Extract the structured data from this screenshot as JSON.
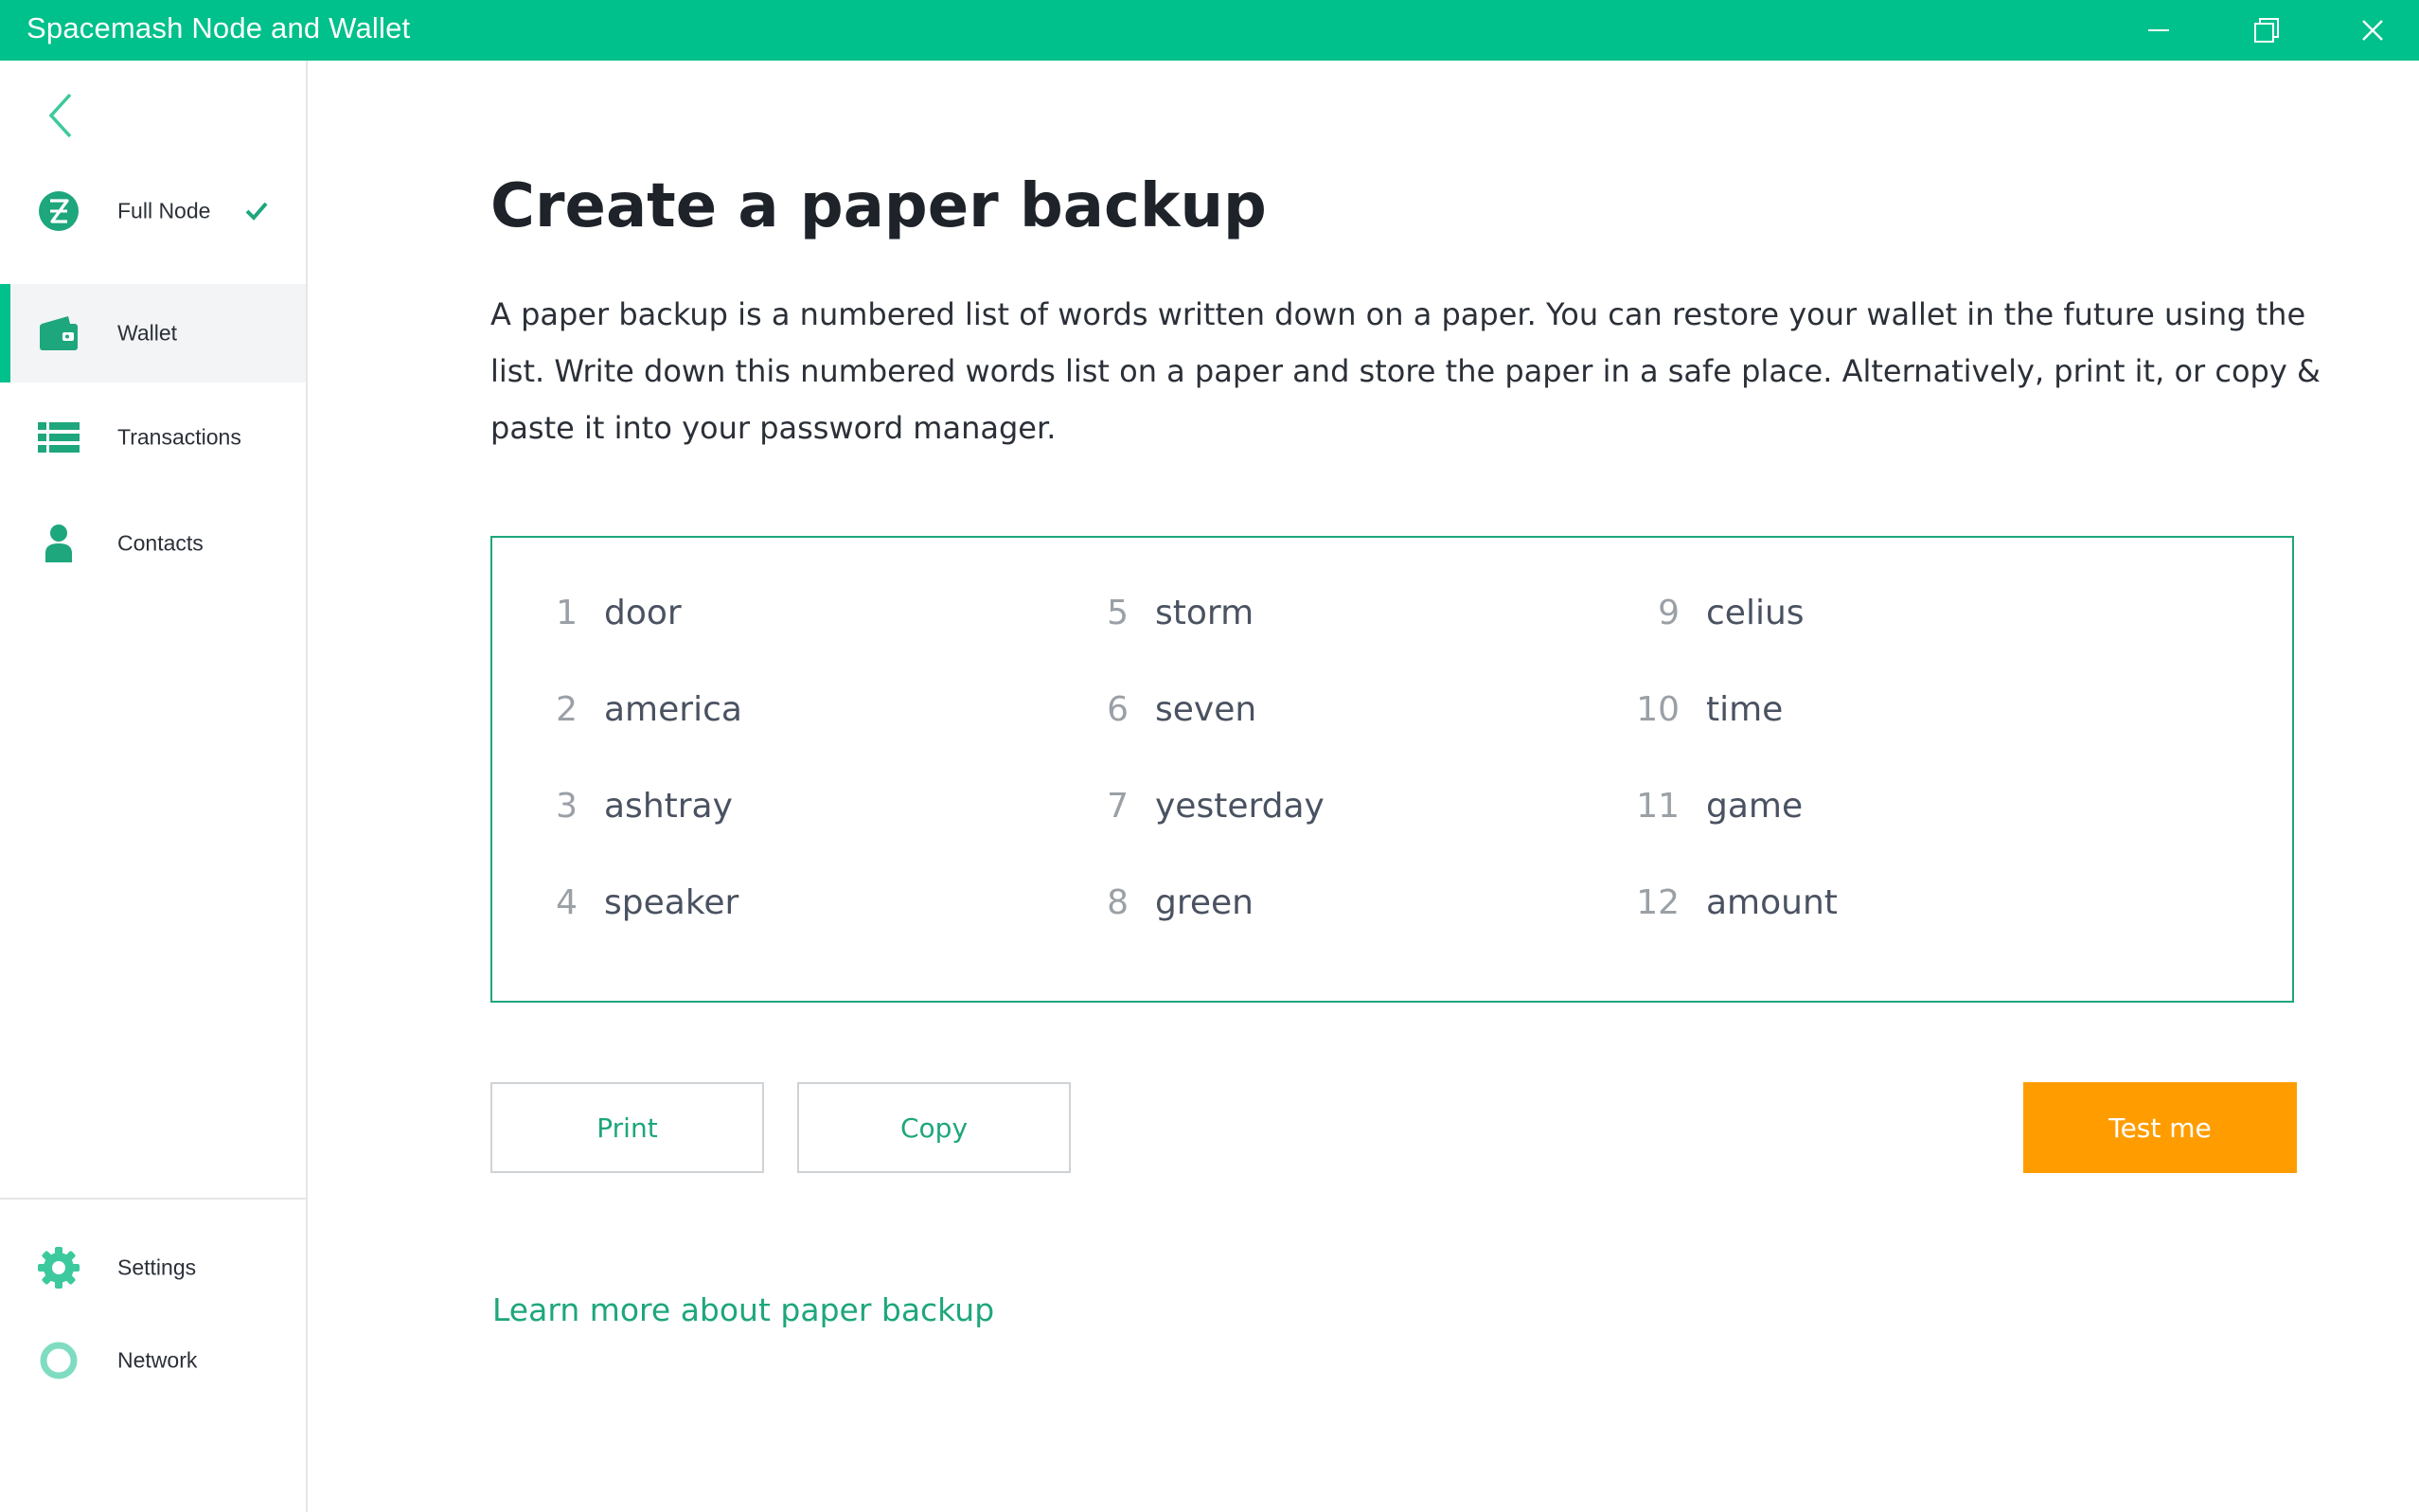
{
  "window": {
    "title": "Spacemash Node and Wallet",
    "accent_color": "#00c08b",
    "controls": [
      "minimize-icon",
      "restore-icon",
      "close-icon"
    ]
  },
  "sidebar": {
    "back_icon": "chevron-left-icon",
    "items": [
      {
        "label": "Full Node",
        "icon": "spacemesh-logo-icon",
        "status_icon": "check-icon"
      },
      {
        "label": "Wallet",
        "icon": "wallet-icon",
        "active": true
      },
      {
        "label": "Transactions",
        "icon": "list-icon"
      },
      {
        "label": "Contacts",
        "icon": "person-icon"
      }
    ],
    "bottom_items": [
      {
        "label": "Settings",
        "icon": "gear-icon"
      },
      {
        "label": "Network",
        "icon": "ring-icon"
      }
    ]
  },
  "main": {
    "heading": "Create a paper backup",
    "description": "A paper backup is a numbered list of words written down on a paper. You can restore your wallet in the future using the list. Write down this numbered words list on a paper and store the paper in a safe place.  Alternatively, print it, or copy & paste it into your password manager.",
    "words": [
      {
        "n": "1",
        "w": "door"
      },
      {
        "n": "2",
        "w": "america"
      },
      {
        "n": "3",
        "w": "ashtray"
      },
      {
        "n": "4",
        "w": "speaker"
      },
      {
        "n": "5",
        "w": "storm"
      },
      {
        "n": "6",
        "w": "seven"
      },
      {
        "n": "7",
        "w": "yesterday"
      },
      {
        "n": "8",
        "w": "green"
      },
      {
        "n": "9",
        "w": "celius"
      },
      {
        "n": "10",
        "w": "time"
      },
      {
        "n": "11",
        "w": "game"
      },
      {
        "n": "12",
        "w": "amount"
      }
    ],
    "buttons": {
      "print": "Print",
      "copy": "Copy",
      "test": "Test me"
    },
    "learn_more": "Learn more about paper backup",
    "colors": {
      "button_primary": "#ff9d00",
      "link": "#1ea67c",
      "box_border": "#1ea67c"
    }
  }
}
